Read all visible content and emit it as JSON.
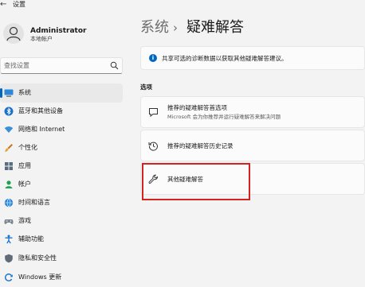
{
  "window": {
    "back_glyph": "←",
    "title": "设置"
  },
  "user": {
    "name": "Administrator",
    "account_type": "本地帐户"
  },
  "search": {
    "placeholder": "查找设置"
  },
  "nav": {
    "items": [
      {
        "label": "系统",
        "icon": "system-icon",
        "active": true
      },
      {
        "label": "蓝牙和其他设备",
        "icon": "bluetooth-icon"
      },
      {
        "label": "网络和 Internet",
        "icon": "wifi-icon"
      },
      {
        "label": "个性化",
        "icon": "brush-icon"
      },
      {
        "label": "应用",
        "icon": "apps-icon"
      },
      {
        "label": "帐户",
        "icon": "account-icon"
      },
      {
        "label": "时间和语言",
        "icon": "globe-clock-icon"
      },
      {
        "label": "游戏",
        "icon": "gamepad-icon"
      },
      {
        "label": "辅助功能",
        "icon": "accessibility-icon"
      },
      {
        "label": "隐私和安全性",
        "icon": "shield-icon"
      },
      {
        "label": "Windows 更新",
        "icon": "update-icon"
      }
    ]
  },
  "breadcrumb": {
    "parent": "系统",
    "separator": "›",
    "current": "疑难解答"
  },
  "info_bar": {
    "icon": "info-icon",
    "text": "共享可选的诊断数据以获取其他疑难解答建议。"
  },
  "section_title": "选项",
  "cards": [
    {
      "title": "推荐的疑难解答首选项",
      "description": "Microsoft 会为你推荐并运行疑难解答来解决问题",
      "icon": "chat-bubble-icon"
    },
    {
      "title": "推荐的疑难解答历史记录",
      "icon": "history-icon"
    },
    {
      "title": "其他疑难解答",
      "icon": "wrench-icon"
    }
  ],
  "colors": {
    "accent": "#0067c0",
    "highlight": "#d4221e"
  }
}
